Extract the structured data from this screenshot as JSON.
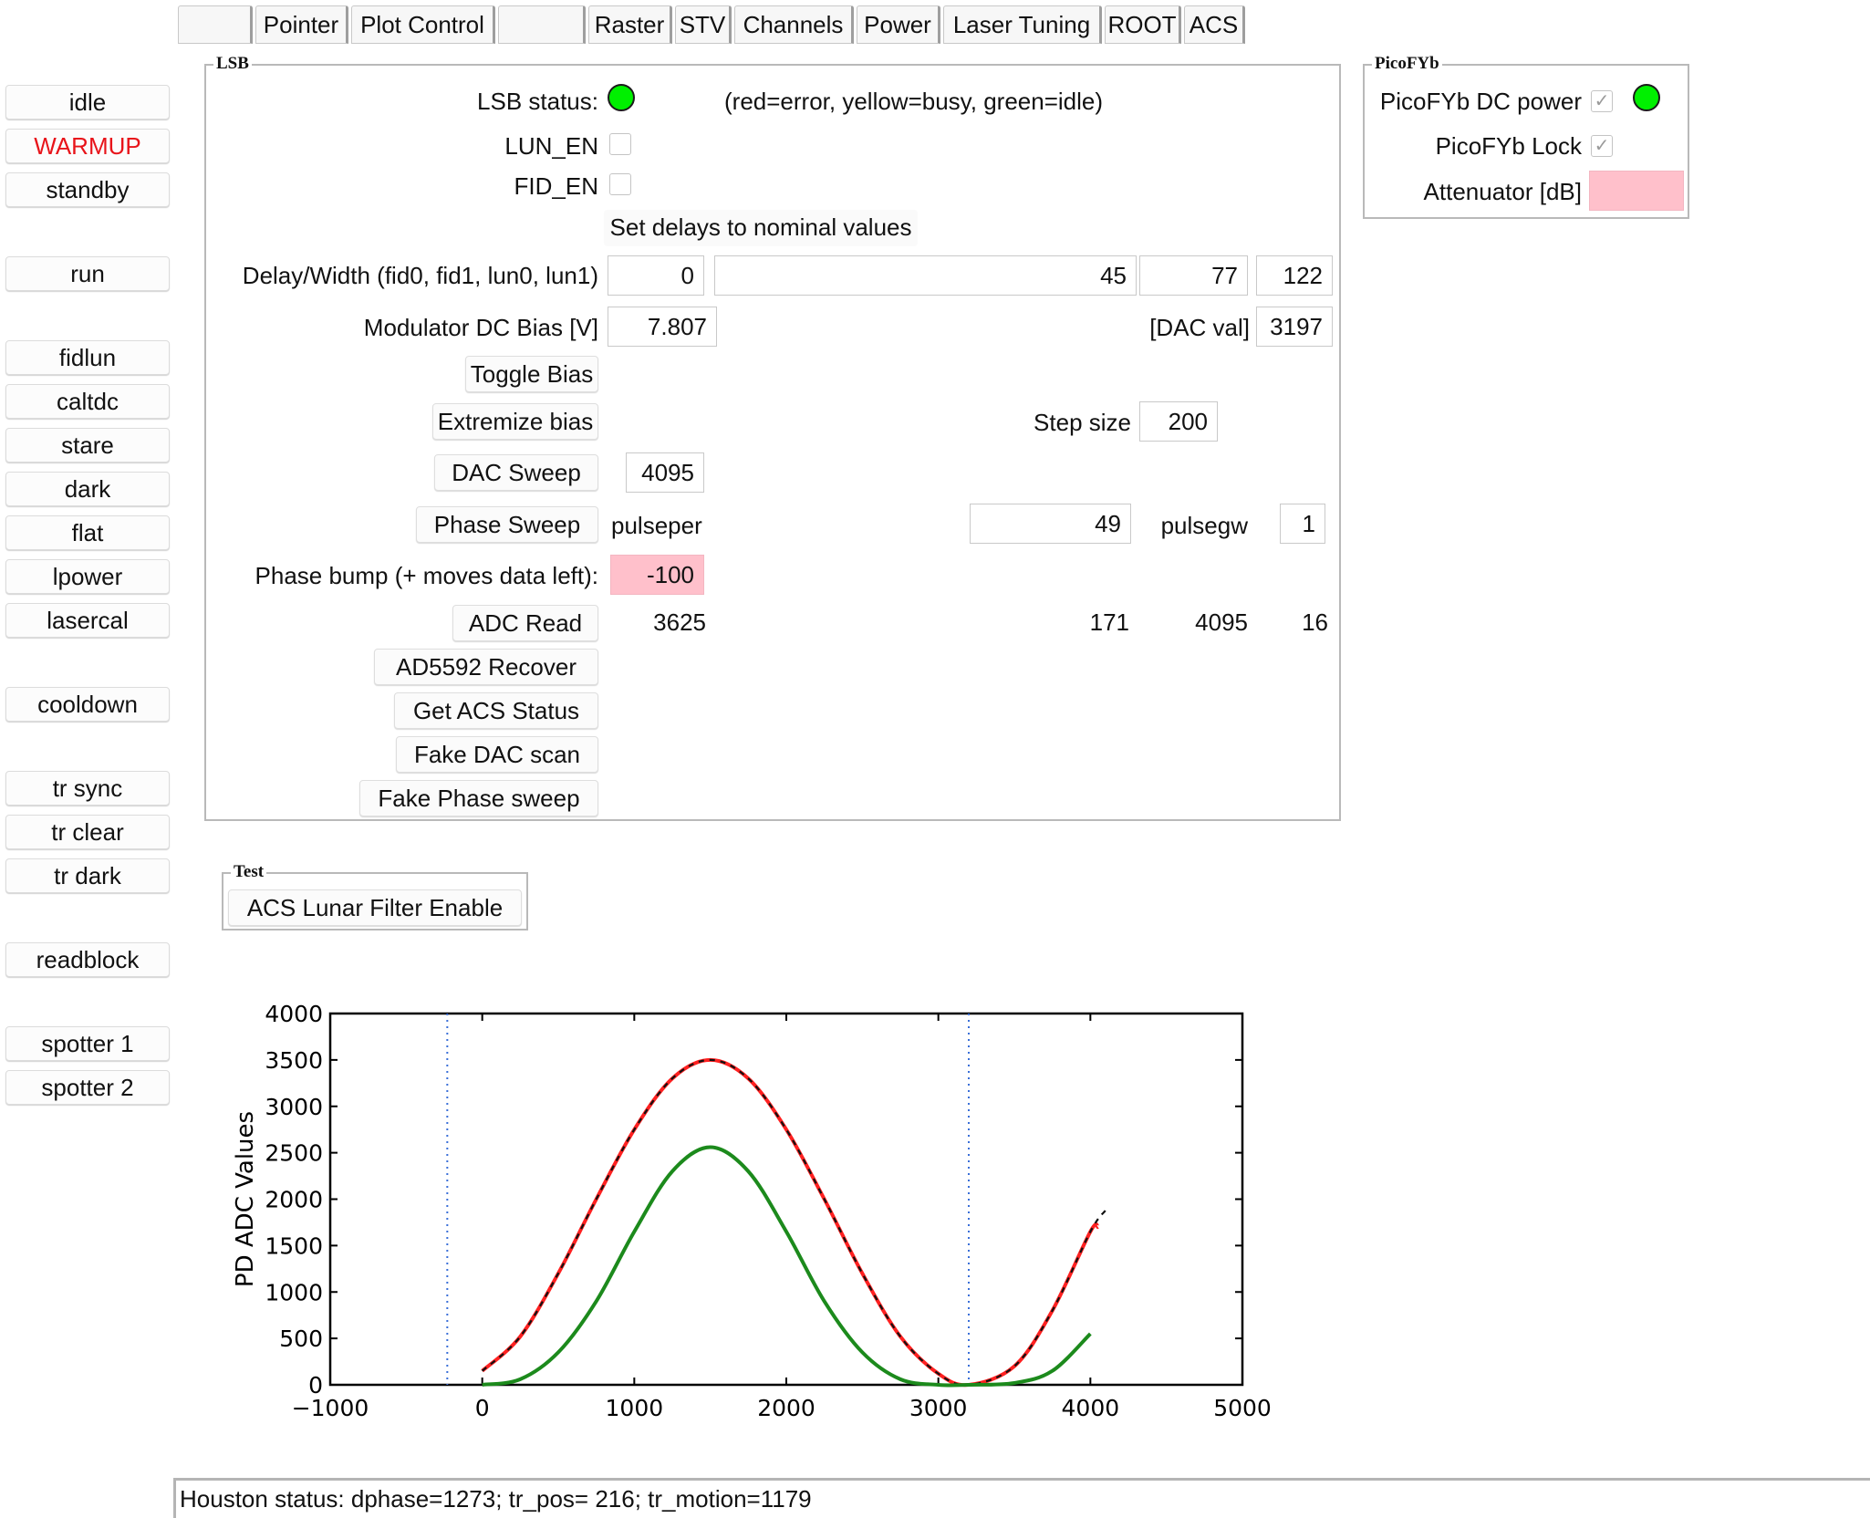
{
  "tabs": [
    "",
    "Pointer",
    "Plot Control",
    "",
    "Raster",
    "STV",
    "Channels",
    "Power",
    "Laser Tuning",
    "ROOT",
    "ACS"
  ],
  "left_buttons": [
    "idle",
    "WARMUP",
    "standby",
    "run",
    "fidlun",
    "caltdc",
    "stare",
    "dark",
    "flat",
    "lpower",
    "lasercal",
    "cooldown",
    "tr sync",
    "tr clear",
    "tr dark",
    "readblock",
    "spotter 1",
    "spotter 2"
  ],
  "lsb": {
    "title": "LSB",
    "status_label": "LSB status:",
    "status_color": "#00f000",
    "status_hint": "(red=error, yellow=busy, green=idle)",
    "lun_en_label": "LUN_EN",
    "lun_en_checked": false,
    "fid_en_label": "FID_EN",
    "fid_en_checked": false,
    "set_delays_label": "Set delays to nominal values",
    "delay_label": "Delay/Width (fid0, fid1, lun0, lun1)",
    "delay_values": [
      "0",
      "45",
      "77",
      "122"
    ],
    "bias_label": "Modulator DC Bias [V]",
    "bias_value": "7.807",
    "dac_val_label": "[DAC val]",
    "dac_val": "3197",
    "toggle_bias_label": "Toggle Bias",
    "extremize_bias_label": "Extremize bias",
    "step_size_label": "Step size",
    "step_size": "200",
    "dac_sweep_label": "DAC Sweep",
    "dac_sweep_value": "4095",
    "phase_sweep_label": "Phase Sweep",
    "pulseper_label": "pulseper",
    "pulseper_value": "49",
    "pulsegw_label": "pulsegw",
    "pulsegw_value": "1",
    "phase_bump_label": "Phase bump (+ moves data left):",
    "phase_bump_value": "-100",
    "adc_read_label": "ADC Read",
    "adc_values": [
      "3625",
      "171",
      "4095",
      "16"
    ],
    "ad5592_label": "AD5592 Recover",
    "get_acs_label": "Get ACS Status",
    "fake_dac_label": "Fake DAC scan",
    "fake_phase_label": "Fake Phase sweep"
  },
  "picofyb": {
    "title": "PicoFYb",
    "dc_power_label": "PicoFYb DC power",
    "dc_power_checked": true,
    "dc_power_led_color": "#00f000",
    "lock_label": "PicoFYb Lock",
    "lock_checked": true,
    "attenuator_label": "Attenuator [dB]",
    "attenuator_value": ""
  },
  "test": {
    "title": "Test",
    "acs_lunar_label": "ACS Lunar Filter Enable"
  },
  "status_bar": "Houston status: dphase=1273;  tr_pos= 216;  tr_motion=1179",
  "chart_data": {
    "type": "line",
    "title": "",
    "xlabel": "",
    "ylabel": "PD ADC Values",
    "xlim": [
      -1000,
      5000
    ],
    "ylim": [
      0,
      4000
    ],
    "xticks": [
      -1000,
      0,
      1000,
      2000,
      3000,
      4000,
      5000
    ],
    "yticks": [
      0,
      500,
      1000,
      1500,
      2000,
      2500,
      3000,
      3500,
      4000
    ],
    "xtick_labels": [
      "−1000",
      "0",
      "1000",
      "2000",
      "3000",
      "4000",
      "5000"
    ],
    "ytick_labels": [
      "0",
      "500",
      "1000",
      "1500",
      "2000",
      "2500",
      "3000",
      "3500",
      "4000"
    ],
    "vlines": [
      {
        "x": -230,
        "color": "#3a6fd8",
        "style": "dotted"
      },
      {
        "x": 3200,
        "color": "#3a6fd8",
        "style": "dotted"
      }
    ],
    "series": [
      {
        "color": "#ff2020",
        "style": "solid",
        "x": [
          0,
          250,
          500,
          750,
          1000,
          1250,
          1500,
          1750,
          2000,
          2250,
          2500,
          2750,
          3000,
          3200,
          3500,
          3750,
          4000,
          4050
        ],
        "y": [
          150,
          520,
          1200,
          2000,
          2750,
          3300,
          3500,
          3300,
          2750,
          2000,
          1200,
          520,
          120,
          0,
          200,
          800,
          1650,
          1700
        ]
      },
      {
        "color": "#111111",
        "style": "dashed",
        "x": [
          0,
          250,
          500,
          750,
          1000,
          1250,
          1500,
          1750,
          2000,
          2250,
          2500,
          2750,
          3000,
          3200,
          3500,
          3750,
          4000,
          4100
        ],
        "y": [
          150,
          520,
          1200,
          2000,
          2750,
          3300,
          3500,
          3300,
          2750,
          2000,
          1200,
          520,
          120,
          0,
          200,
          800,
          1650,
          1880
        ]
      },
      {
        "color": "#1c8a1c",
        "style": "solid",
        "x": [
          0,
          250,
          500,
          750,
          1000,
          1250,
          1500,
          1750,
          2000,
          2250,
          2500,
          2750,
          3000,
          3200,
          3500,
          3750,
          4000
        ],
        "y": [
          0,
          60,
          350,
          900,
          1650,
          2300,
          2560,
          2300,
          1650,
          900,
          350,
          60,
          0,
          0,
          20,
          150,
          550
        ]
      }
    ]
  }
}
